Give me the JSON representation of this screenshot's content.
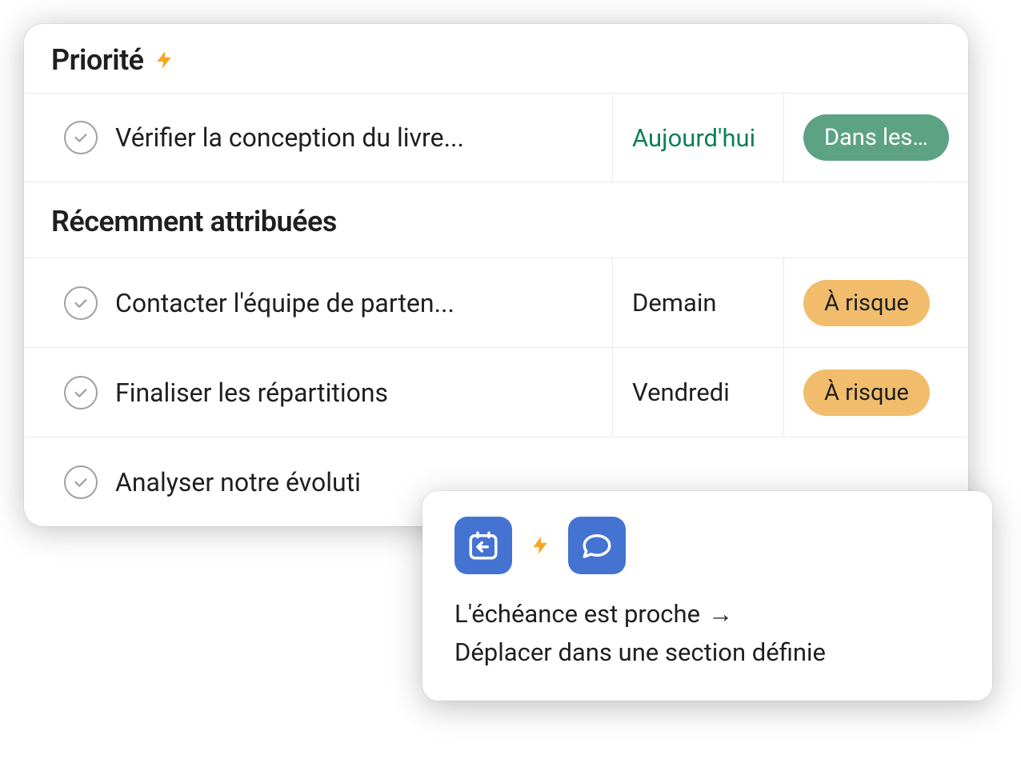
{
  "sections": {
    "priority": {
      "title": "Priorité",
      "tasks": [
        {
          "title": "Vérifier la conception du livre...",
          "due": "Aujourd'hui",
          "dueType": "today",
          "status": "Dans les...",
          "statusType": "green"
        }
      ]
    },
    "recent": {
      "title": "Récemment attribuées",
      "tasks": [
        {
          "title": "Contacter l'équipe de parten...",
          "due": "Demain",
          "dueType": "normal",
          "status": "À risque",
          "statusType": "orange"
        },
        {
          "title": "Finaliser les répartitions",
          "due": "Vendredi",
          "dueType": "normal",
          "status": "À risque",
          "statusType": "orange"
        },
        {
          "title": "Analyser notre évoluti",
          "due": "",
          "dueType": "normal",
          "status": "",
          "statusType": ""
        }
      ]
    }
  },
  "popup": {
    "line1": "L'échéance est proche",
    "line2": "Déplacer dans une section définie"
  }
}
